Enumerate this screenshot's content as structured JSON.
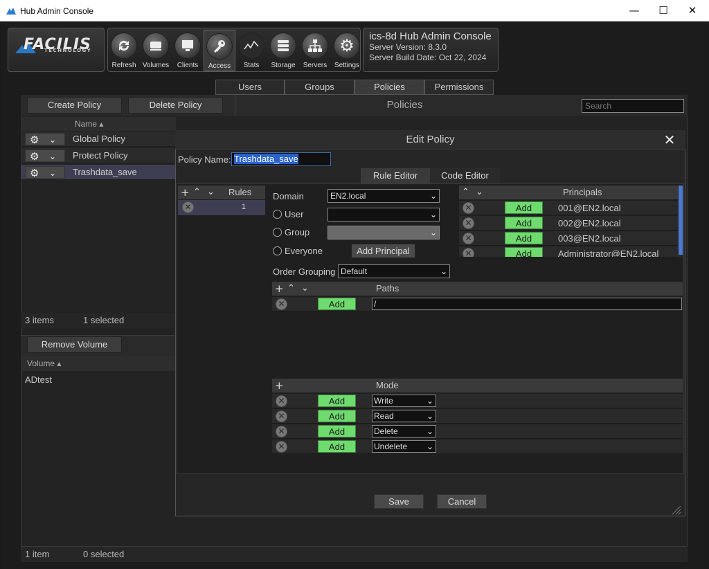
{
  "window": {
    "title": "Hub Admin Console",
    "minimize": "—",
    "maximize": "☐",
    "close": "✕"
  },
  "logo": {
    "line1": "FACILIS",
    "line2": "TECHNOLOGY"
  },
  "toolbar": [
    {
      "label": "Refresh",
      "icon": "refresh-icon"
    },
    {
      "label": "Volumes",
      "icon": "volumes-icon"
    },
    {
      "label": "Clients",
      "icon": "clients-icon"
    },
    {
      "label": "Access",
      "icon": "key-icon"
    },
    {
      "label": "Stats",
      "icon": "stats-icon"
    },
    {
      "label": "Storage",
      "icon": "storage-icon"
    },
    {
      "label": "Servers",
      "icon": "servers-icon"
    },
    {
      "label": "Settings",
      "icon": "settings-icon"
    }
  ],
  "server": {
    "name": "ics-8d Hub Admin Console",
    "version": "Server Version: 8.3.0",
    "build": "Server Build Date: Oct 22, 2024"
  },
  "tabs": [
    "Users",
    "Groups",
    "Policies",
    "Permissions"
  ],
  "policies_toolbar": {
    "create": "Create Policy",
    "delete": "Delete Policy",
    "title": "Policies",
    "search_placeholder": "Search"
  },
  "policy_list": {
    "header": "Name ▴",
    "items": [
      "Global Policy",
      "Protect Policy",
      "Trashdata_save"
    ],
    "status_count": "3 items",
    "status_selected": "1 selected"
  },
  "volumes": {
    "remove_button": "Remove Volume",
    "header": "Volume ▴",
    "items": [
      "ADtest"
    ],
    "status_count": "1 item",
    "status_selected": "0 selected"
  },
  "dialog": {
    "title": "Edit Policy",
    "policy_name_label": "Policy Name:",
    "policy_name_value": "Trashdata_save",
    "subtabs": [
      "Rule Editor",
      "Code Editor"
    ],
    "rules": {
      "header": "Rules",
      "items": [
        "1"
      ]
    },
    "domain_label": "Domain",
    "domain_value": "EN2.local",
    "user_label": "User",
    "group_label": "Group",
    "everyone_label": "Everyone",
    "add_principal": "Add Principal",
    "order_grouping_label": "Order Grouping",
    "order_grouping_value": "Default",
    "principals": {
      "header": "Principals",
      "add_label": "Add",
      "items": [
        "001@EN2.local",
        "002@EN2.local",
        "003@EN2.local",
        "Administrator@EN2.local"
      ]
    },
    "paths": {
      "header": "Paths",
      "add_label": "Add",
      "items": [
        "/"
      ]
    },
    "mode": {
      "header": "Mode",
      "add_label": "Add",
      "items": [
        "Write",
        "Read",
        "Delete",
        "Undelete"
      ]
    },
    "save": "Save",
    "cancel": "Cancel"
  },
  "colors": {
    "add_green": "#6fdb6f",
    "selection_blue": "#2a62c9",
    "selected_row": "#3e3e52"
  }
}
